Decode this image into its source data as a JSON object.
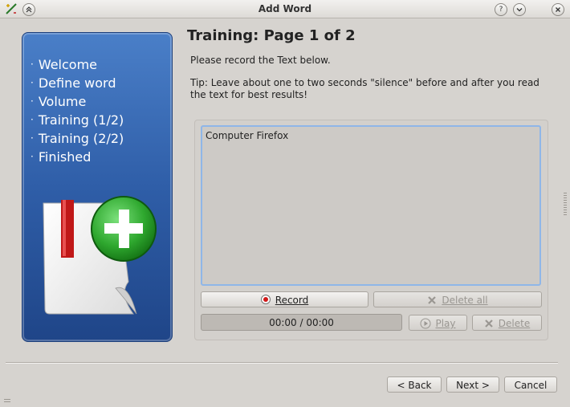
{
  "window": {
    "title": "Add Word"
  },
  "wizard": {
    "steps": [
      "Welcome",
      "Define word",
      "Volume",
      "Training (1/2)",
      "Training (2/2)",
      "Finished"
    ],
    "step_bullet": "·"
  },
  "page": {
    "heading": "Training: Page 1 of 2",
    "instruction": "Please record the Text below.",
    "tip": "Tip: Leave about one to two seconds \"silence\" before and after you read the text for best results!",
    "prompt_text": "Computer Firefox"
  },
  "recorder": {
    "record_label": "Record",
    "delete_all_label": "Delete all",
    "time_display": "00:00 / 00:00",
    "play_label": "Play",
    "delete_label": "Delete"
  },
  "footer": {
    "back_label": "< Back",
    "next_label": "Next >",
    "cancel_label": "Cancel"
  },
  "colors": {
    "sidebar_top": "#4a7fc8",
    "sidebar_bottom": "#1f4588",
    "record_red": "#d01818",
    "focus_blue": "#8fb6e8",
    "plus_green": "#2fa82f"
  },
  "icons": {
    "app": "app-icon",
    "shade": "shade-up-icon",
    "help": "help-icon",
    "minimize": "minimize-icon",
    "close": "close-icon",
    "illustration": "add-document-icon",
    "record": "record-icon",
    "delete_all": "delete-icon",
    "play": "play-icon",
    "delete": "delete-icon"
  }
}
